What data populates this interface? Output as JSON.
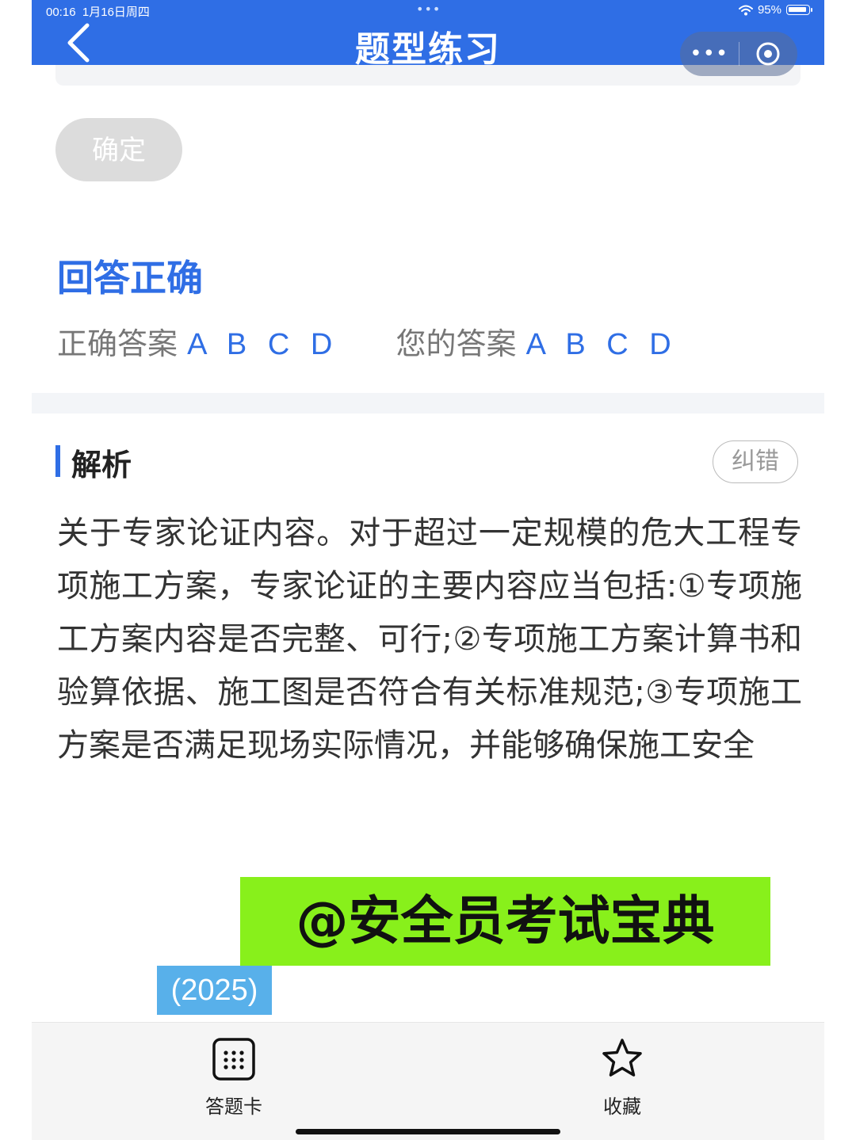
{
  "status_bar": {
    "time": "00:16",
    "date": "1月16日周四",
    "dots": "•••",
    "battery": "95%"
  },
  "nav": {
    "title": "题型练习",
    "menu_dots": "•••"
  },
  "confirm_button": "确定",
  "result": {
    "status": "回答正确",
    "correct_label": "正确答案",
    "correct_value": "A B C D",
    "yours_label": "您的答案",
    "yours_value": "A B C D"
  },
  "analysis": {
    "title": "解析",
    "report_button": "纠错",
    "text": "关于专家论证内容。对于超过一定规模的危大工程专项施工方案，专家论证的主要内容应当包括:①专项施工方案内容是否完整、可行;②专项施工方案计算书和验算依据、施工图是否符合有关标准规范;③专项施工方案是否满足现场实际情况，并能够确保施工安全"
  },
  "watermark": {
    "text": "@安全员考试宝典",
    "year": "(2025)"
  },
  "bottom_tabs": [
    {
      "label": "答题卡",
      "icon": "grid-icon"
    },
    {
      "label": "收藏",
      "icon": "star-icon"
    }
  ],
  "colors": {
    "primary": "#2f6ee5",
    "watermark_bg": "#88f01b",
    "year_bg": "#58b0ea"
  }
}
